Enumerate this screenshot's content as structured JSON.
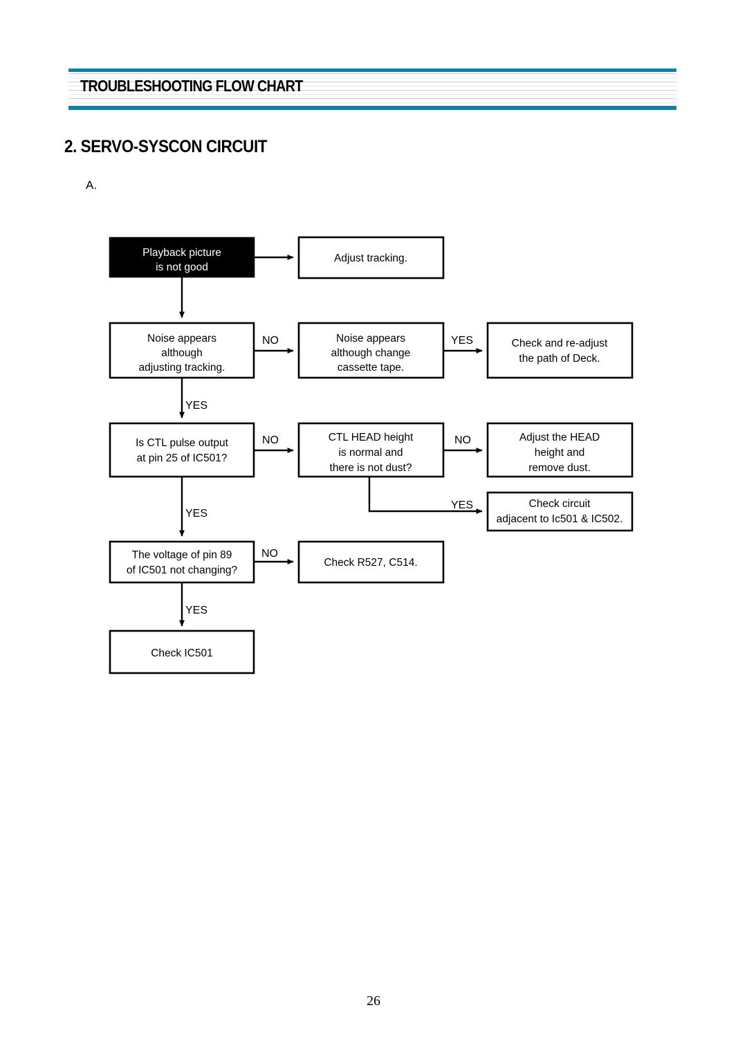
{
  "header": {
    "title": "TROUBLESHOOTING FLOW CHART",
    "rule_color": "#1180a6"
  },
  "section": {
    "title": "2. SERVO-SYSCON CIRCUIT",
    "subsection_label": "A."
  },
  "footer": {
    "page_number": "26"
  },
  "flowchart": {
    "nodes": {
      "playback": {
        "lines": [
          "Playback picture",
          "is not good"
        ],
        "style": "filled"
      },
      "adjust_tracking": {
        "lines": [
          "Adjust tracking."
        ],
        "style": "plain"
      },
      "noise_tracking": {
        "lines": [
          "Noise appears",
          "although",
          "adjusting tracking."
        ],
        "style": "plain"
      },
      "noise_cassette": {
        "lines": [
          "Noise appears",
          "although change",
          "cassette tape."
        ],
        "style": "plain"
      },
      "check_deck_path": {
        "lines": [
          "Check and re-adjust",
          "the path of Deck."
        ],
        "style": "plain"
      },
      "ctl_pulse": {
        "lines": [
          "Is CTL pulse output",
          "at pin 25 of IC501?"
        ],
        "style": "plain"
      },
      "ctl_head": {
        "lines": [
          "CTL HEAD height",
          "is normal and",
          "there is not dust?"
        ],
        "style": "plain"
      },
      "adjust_head": {
        "lines": [
          "Adjust the HEAD",
          "height and",
          "remove dust."
        ],
        "style": "plain"
      },
      "check_circuit": {
        "lines": [
          "Check circuit",
          "adjacent to Ic501 & IC502."
        ],
        "style": "plain"
      },
      "voltage_pin89": {
        "lines": [
          "The voltage of pin 89",
          "of IC501 not changing?"
        ],
        "style": "plain"
      },
      "check_r527": {
        "lines": [
          "Check R527, C514."
        ],
        "style": "plain"
      },
      "check_ic501": {
        "lines": [
          "Check IC501"
        ],
        "style": "plain"
      }
    },
    "edge_labels": {
      "noise_tracking_no": "NO",
      "noise_cassette_yes": "YES",
      "noise_tracking_yes": "YES",
      "ctl_pulse_no": "NO",
      "ctl_head_no": "NO",
      "ctl_head_yes": "YES",
      "ctl_pulse_yes": "YES",
      "voltage_no": "NO",
      "voltage_yes": "YES"
    }
  }
}
